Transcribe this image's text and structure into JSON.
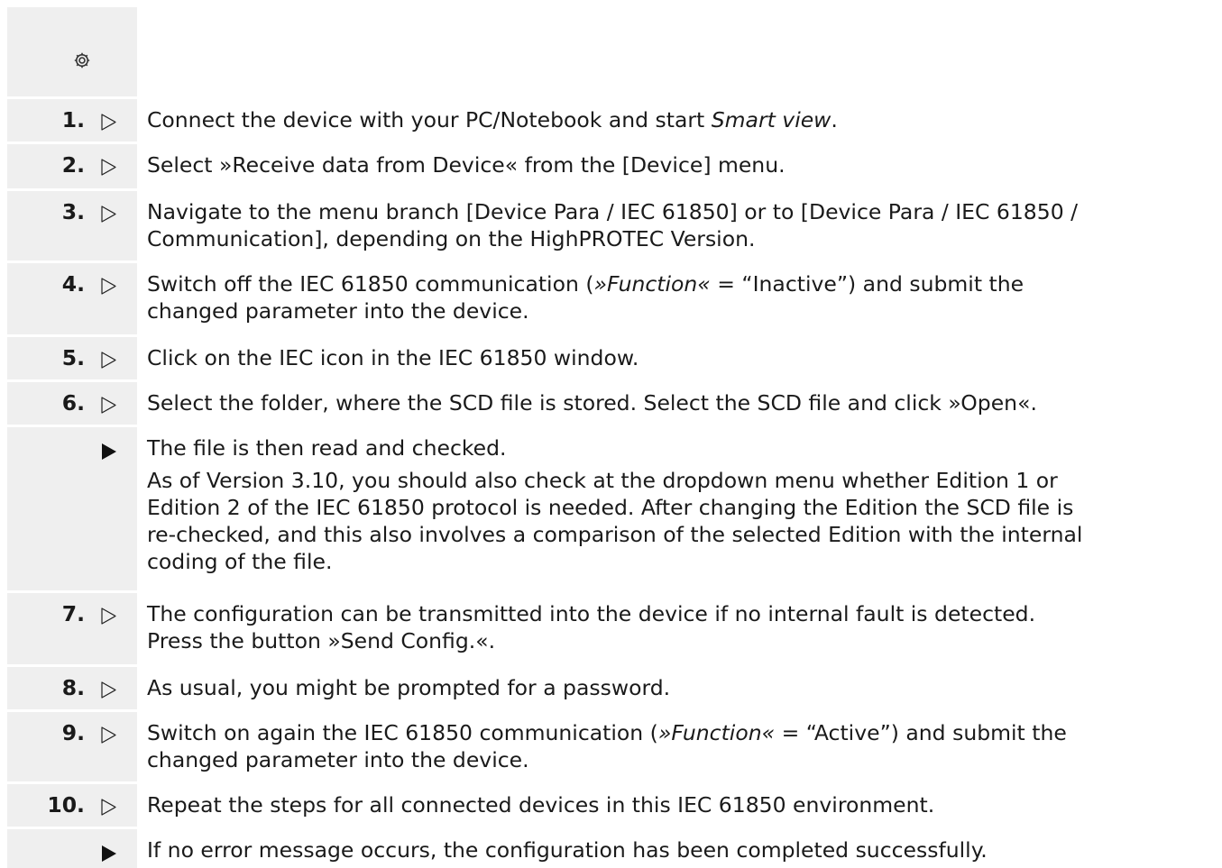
{
  "header": {
    "icon": "gear-icon"
  },
  "steps": [
    {
      "num": "1.",
      "marker": "hollow-triangle",
      "lines": [
        [
          {
            "t": "Connect the device with your PC/Notebook and start "
          },
          {
            "t": "Smart view",
            "i": true
          },
          {
            "t": "."
          }
        ]
      ]
    },
    {
      "num": "2.",
      "marker": "hollow-triangle",
      "lines": [
        [
          {
            "t": "Select »Receive data from Device« from the [Device] menu."
          }
        ]
      ]
    },
    {
      "num": "3.",
      "marker": "hollow-triangle",
      "lines": [
        [
          {
            "t": "Navigate to the menu branch [Device Para / IEC 61850] or to [Device Para / IEC 61850 /"
          }
        ],
        [
          {
            "t": "Communication], depending on the HighPROTEC Version."
          }
        ]
      ]
    },
    {
      "num": "4.",
      "marker": "hollow-triangle",
      "lines": [
        [
          {
            "t": "Switch off the IEC 61850 communication ("
          },
          {
            "t": "»Function«",
            "i": true
          },
          {
            "t": " = “Inactive”) and submit the"
          }
        ],
        [
          {
            "t": "changed parameter into the device."
          }
        ]
      ]
    },
    {
      "num": "5.",
      "marker": "hollow-triangle",
      "lines": [
        [
          {
            "t": "Click on the IEC icon in the IEC 61850 window."
          }
        ]
      ]
    },
    {
      "num": "6.",
      "marker": "hollow-triangle",
      "lines": [
        [
          {
            "t": "Select the folder, where the SCD file is stored. Select the SCD file and click »Open«."
          }
        ]
      ]
    },
    {
      "num": "",
      "marker": "solid-triangle",
      "lines": [
        [
          {
            "t": "The file is then read and checked."
          }
        ]
      ],
      "extra_lines": [
        [
          {
            "t": "As of Version 3.10, you should also check at the dropdown menu whether Edition 1 or"
          }
        ],
        [
          {
            "t": "Edition 2 of the IEC 61850 protocol is needed. After changing the Edition the SCD file is"
          }
        ],
        [
          {
            "t": "re-checked, and this also involves a comparison of the selected Edition with the internal"
          }
        ],
        [
          {
            "t": "coding of the file."
          }
        ]
      ]
    },
    {
      "num": "7.",
      "marker": "hollow-triangle",
      "lines": [
        [
          {
            "t": "The configuration can be transmitted into the device if no internal fault is detected."
          }
        ],
        [
          {
            "t": "Press the button »Send Config.«."
          }
        ]
      ]
    },
    {
      "num": "8.",
      "marker": "hollow-triangle",
      "lines": [
        [
          {
            "t": "As usual, you might be prompted for a password."
          }
        ]
      ]
    },
    {
      "num": "9.",
      "marker": "hollow-triangle",
      "lines": [
        [
          {
            "t": "Switch on again the IEC 61850 communication ("
          },
          {
            "t": "»Function«",
            "i": true
          },
          {
            "t": " = “Active”) and submit the"
          }
        ],
        [
          {
            "t": "changed parameter into the device."
          }
        ]
      ]
    },
    {
      "num": "10.",
      "marker": "hollow-triangle",
      "lines": [
        [
          {
            "t": "Repeat the steps for all connected devices in this IEC 61850 environment."
          }
        ]
      ]
    },
    {
      "num": "",
      "marker": "solid-triangle",
      "lines": [
        [
          {
            "t": "If no error message occurs, the configuration has been completed successfully."
          }
        ]
      ]
    }
  ]
}
